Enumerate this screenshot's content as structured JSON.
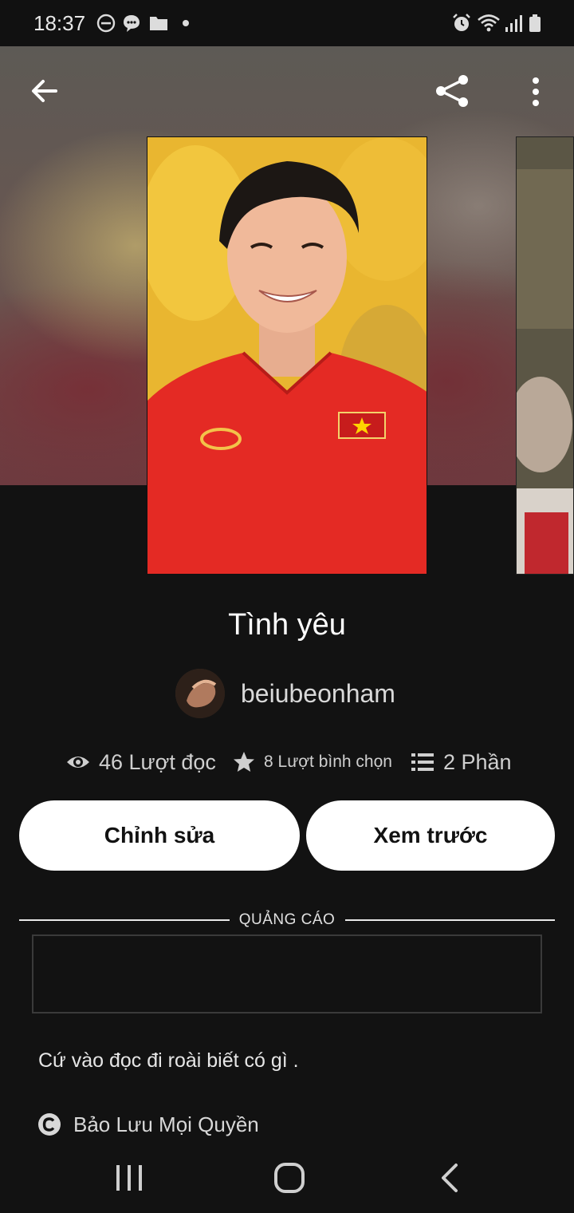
{
  "status_bar": {
    "time": "18:37",
    "left_icons": [
      "do-not-disturb-icon",
      "chat-icon",
      "folder-icon",
      "dot-icon"
    ],
    "right_icons": [
      "alarm-icon",
      "wifi-icon",
      "signal-icon",
      "battery-icon"
    ]
  },
  "header": {
    "back_icon": "arrow-left-icon",
    "share_icon": "share-icon",
    "menu_icon": "more-vertical-icon"
  },
  "story": {
    "title": "Tình yêu",
    "author": "beiubeonham",
    "stats": {
      "reads": "46 Lượt đọc",
      "votes": "8 Lượt bình chọn",
      "parts": "2 Phần"
    }
  },
  "actions": {
    "edit_label": "Chỉnh sửa",
    "preview_label": "Xem trước"
  },
  "ad": {
    "label": "QUẢNG CÁO"
  },
  "description": "Cứ vào đọc đi roài biết có gì .",
  "copyright": "Bảo Lưu Mọi Quyền",
  "colors": {
    "background": "#121212",
    "button": "#ffffff",
    "text_primary": "#ffffff",
    "text_secondary": "#cfcfcf"
  }
}
